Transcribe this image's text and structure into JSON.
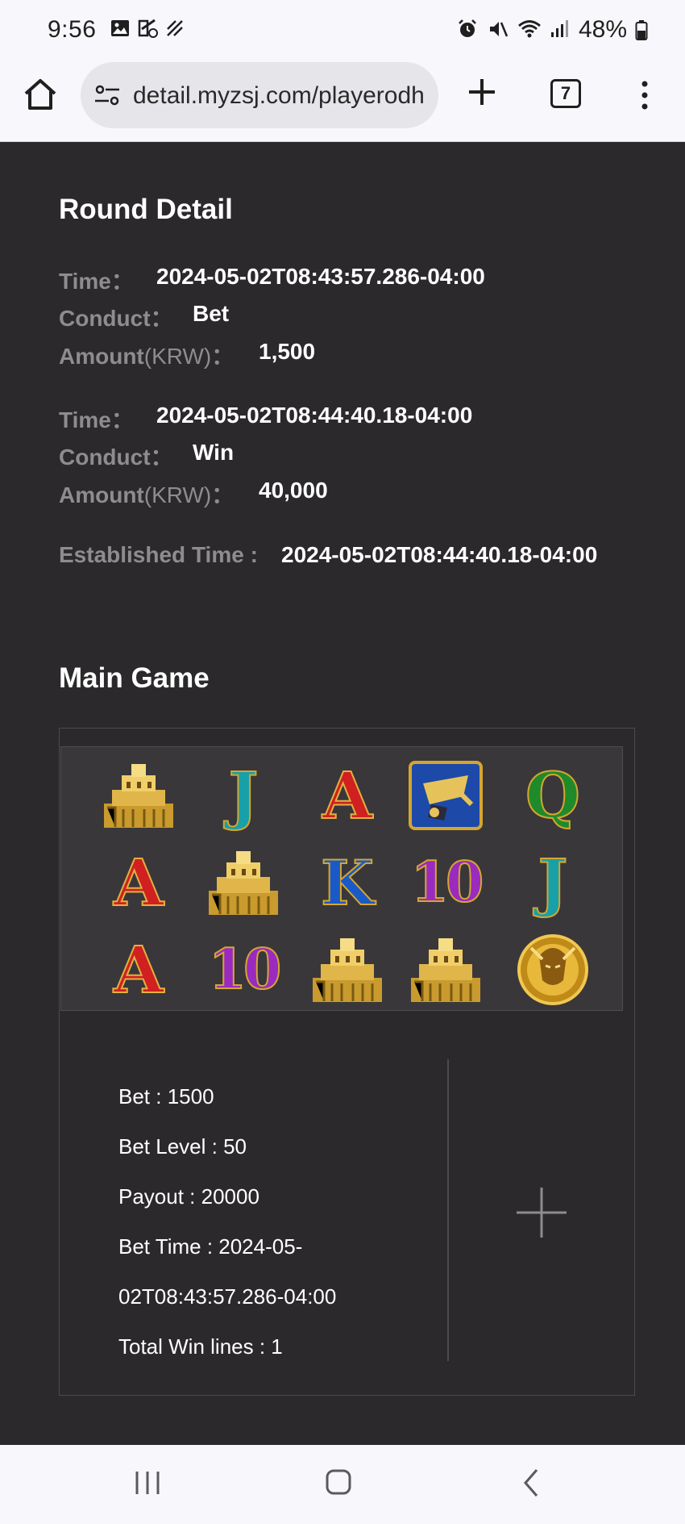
{
  "status_bar": {
    "time": "9:56",
    "battery": "48%",
    "left_icons": [
      "gallery-icon",
      "missed-call-icon",
      "no-signal-icon"
    ],
    "right_icons": [
      "alarm-icon",
      "mute-icon",
      "wifi-icon",
      "signal-icon",
      "battery-icon"
    ]
  },
  "browser": {
    "url": "detail.myzsj.com/playerodh",
    "tab_count": "7"
  },
  "round_detail": {
    "title": "Round Detail",
    "entries": [
      {
        "time_label": "Time：",
        "time_value": "2024-05-02T08:43:57.286-04:00",
        "conduct_label": "Conduct：",
        "conduct_value": "Bet",
        "amount_label": "Amount",
        "amount_unit": "(KRW)",
        "amount_colon": "：",
        "amount_value": "1,500"
      },
      {
        "time_label": "Time：",
        "time_value": "2024-05-02T08:44:40.18-04:00",
        "conduct_label": "Conduct：",
        "conduct_value": "Win",
        "amount_label": "Amount",
        "amount_unit": "(KRW)",
        "amount_colon": "：",
        "amount_value": "40,000"
      }
    ],
    "established_label": "Established Time :",
    "established_value": "2024-05-02T08:44:40.18-04:00"
  },
  "main_game": {
    "title": "Main Game",
    "reels": [
      [
        "palace",
        "J",
        "A",
        "scatter-box",
        "Q"
      ],
      [
        "A",
        "palace",
        "K",
        "10",
        "J"
      ],
      [
        "A",
        "10",
        "palace",
        "palace",
        "warrior"
      ]
    ],
    "info": {
      "bet": "Bet : 1500",
      "bet_level": "Bet Level : 50",
      "payout": "Payout : 20000",
      "bet_time_1": "Bet Time : 2024-05-",
      "bet_time_2": "02T08:43:57.286-04:00",
      "total_win_lines": "Total Win lines : 1"
    }
  }
}
